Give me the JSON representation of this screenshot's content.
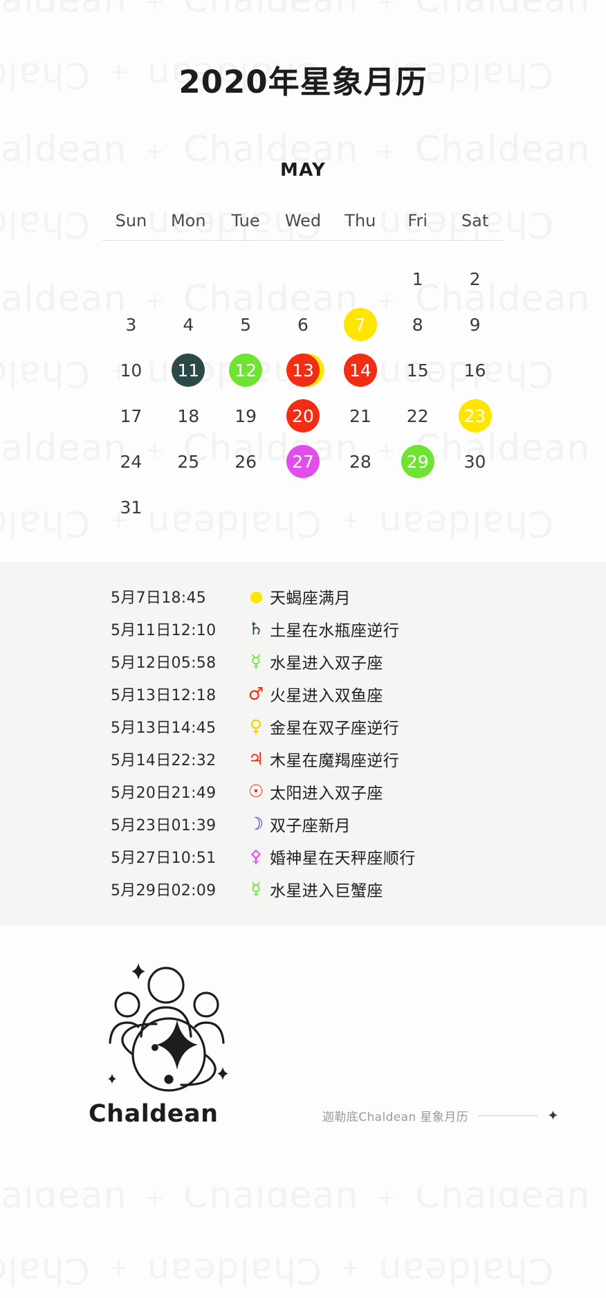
{
  "brand": {
    "name": "Chaldean",
    "watermark_text": "Chaldean",
    "watermark_plus": "+"
  },
  "header": {
    "title": "2020年星象月历",
    "month_label": "MAY"
  },
  "calendar": {
    "weekdays": [
      "Sun",
      "Mon",
      "Tue",
      "Wed",
      "Thu",
      "Fri",
      "Sat"
    ],
    "leading_blanks": 5,
    "days": [
      {
        "n": "1"
      },
      {
        "n": "2"
      },
      {
        "n": "3"
      },
      {
        "n": "4"
      },
      {
        "n": "5"
      },
      {
        "n": "6"
      },
      {
        "n": "7",
        "color": "#ffe500"
      },
      {
        "n": "8"
      },
      {
        "n": "9"
      },
      {
        "n": "10"
      },
      {
        "n": "11",
        "color": "#2b4a47"
      },
      {
        "n": "12",
        "color": "#6ee331"
      },
      {
        "n": "13",
        "color": "#f22d13",
        "behind": "#ffe500"
      },
      {
        "n": "14",
        "color": "#f22d13"
      },
      {
        "n": "15"
      },
      {
        "n": "16"
      },
      {
        "n": "17"
      },
      {
        "n": "18"
      },
      {
        "n": "19"
      },
      {
        "n": "20",
        "color": "#f22d13"
      },
      {
        "n": "21"
      },
      {
        "n": "22"
      },
      {
        "n": "23",
        "color": "#ffe500"
      },
      {
        "n": "24"
      },
      {
        "n": "25"
      },
      {
        "n": "26"
      },
      {
        "n": "27",
        "color": "#e24ee8"
      },
      {
        "n": "28"
      },
      {
        "n": "29",
        "color": "#6ee331"
      },
      {
        "n": "30"
      },
      {
        "n": "31"
      }
    ]
  },
  "events": [
    {
      "date": "5月7日18:45",
      "symbol": "●",
      "symbol_name": "full-moon-icon",
      "color": "#ffe500",
      "name": "天蝎座满月"
    },
    {
      "date": "5月11日12:10",
      "symbol": "♄",
      "symbol_name": "saturn-icon",
      "color": "#2b4a47",
      "name": "土星在水瓶座逆行"
    },
    {
      "date": "5月12日05:58",
      "symbol": "☿",
      "symbol_name": "mercury-icon",
      "color": "#6ee331",
      "name": "水星进入双子座"
    },
    {
      "date": "5月13日12:18",
      "symbol": "♂",
      "symbol_name": "mars-icon",
      "color": "#f22d13",
      "name": "火星进入双鱼座"
    },
    {
      "date": "5月13日14:45",
      "symbol": "♀",
      "symbol_name": "venus-icon",
      "color": "#f0d300",
      "name": "金星在双子座逆行"
    },
    {
      "date": "5月14日22:32",
      "symbol": "♃",
      "symbol_name": "jupiter-icon",
      "color": "#f22d13",
      "name": "木星在魔羯座逆行"
    },
    {
      "date": "5月20日21:49",
      "symbol": "☉",
      "symbol_name": "sun-icon",
      "color": "#f22d13",
      "name": "太阳进入双子座"
    },
    {
      "date": "5月23日01:39",
      "symbol": "☽",
      "symbol_name": "new-moon-icon",
      "color": "#2a2ad6",
      "name": "双子座新月"
    },
    {
      "date": "5月27日10:51",
      "symbol": "⚴",
      "symbol_name": "juno-icon",
      "color": "#e24ee8",
      "name": "婚神星在天秤座顺行"
    },
    {
      "date": "5月29日02:09",
      "symbol": "☿",
      "symbol_name": "mercury-icon",
      "color": "#6ee331",
      "name": "水星进入巨蟹座"
    }
  ],
  "footer": {
    "logo_word": "Chaldean",
    "note": "迦勒底Chaldean  星象月历",
    "star": "✦"
  }
}
